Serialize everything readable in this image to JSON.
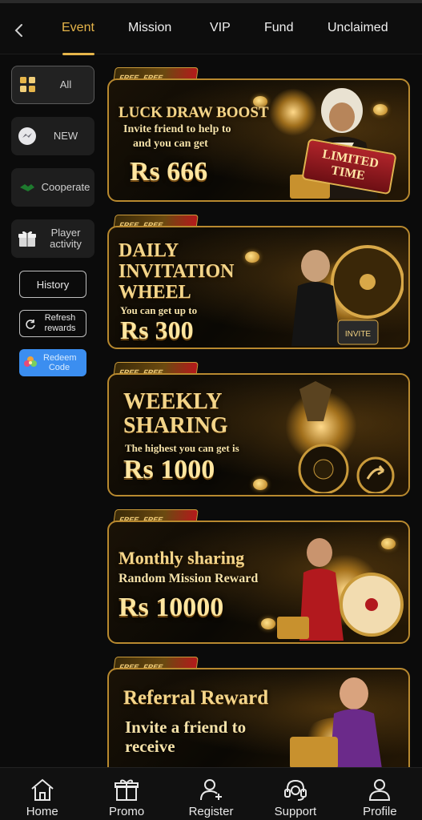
{
  "header": {
    "tabs": [
      {
        "label": "Event",
        "active": true
      },
      {
        "label": "Mission",
        "active": false
      },
      {
        "label": "VIP",
        "active": false
      },
      {
        "label": "Fund",
        "active": false
      },
      {
        "label": "Unclaimed",
        "active": false
      }
    ],
    "back_icon": "chevron-left-icon"
  },
  "sidebar": {
    "items": [
      {
        "label": "All",
        "icon": "grid-icon",
        "active": true
      },
      {
        "label": "NEW",
        "icon": "messenger-icon",
        "active": false
      },
      {
        "label": "Cooperate",
        "icon": "handshake-icon",
        "active": false
      },
      {
        "label": "Player activity",
        "icon": "gift-icon",
        "active": false
      }
    ],
    "buttons": {
      "history": "History",
      "refresh_rewards": "Refresh rewards",
      "redeem_code": "Redeem Code"
    }
  },
  "banners": [
    {
      "title": "LUCK DRAW BOOST",
      "subtitle_1": "Invite friend to help to",
      "subtitle_2": "and you can get",
      "amount": "Rs 666",
      "badge_1": "LIMITED",
      "badge_2": "TIME",
      "ribbon": "FREE"
    },
    {
      "title_1": "DAILY",
      "title_2": "INVITATION",
      "title_3": "WHEEL",
      "subtitle": "You can get up to",
      "amount": "Rs 300",
      "badge": "INVITE",
      "ribbon": "FREE"
    },
    {
      "title_1": "WEEKLY",
      "title_2": "SHARING",
      "subtitle": "The highest you can get is",
      "amount": "Rs 1000",
      "ribbon": "FREE"
    },
    {
      "title": "Monthly sharing",
      "subtitle": "Random Mission Reward",
      "amount": "Rs 10000",
      "ribbon": "FREE"
    },
    {
      "title": "Referral Reward",
      "subtitle_1": "Invite a friend to",
      "subtitle_2": "receive",
      "ribbon": "FREE"
    }
  ],
  "bottom_nav": [
    {
      "label": "Home",
      "icon": "home-icon"
    },
    {
      "label": "Promo",
      "icon": "gift-icon"
    },
    {
      "label": "Register",
      "icon": "add-user-icon"
    },
    {
      "label": "Support",
      "icon": "headset-icon"
    },
    {
      "label": "Profile",
      "icon": "user-icon"
    }
  ],
  "colors": {
    "accent": "#e6b54a",
    "background": "#0b0b0b",
    "redeem": "#3b8ef0",
    "banner_border": "#b8892f"
  }
}
